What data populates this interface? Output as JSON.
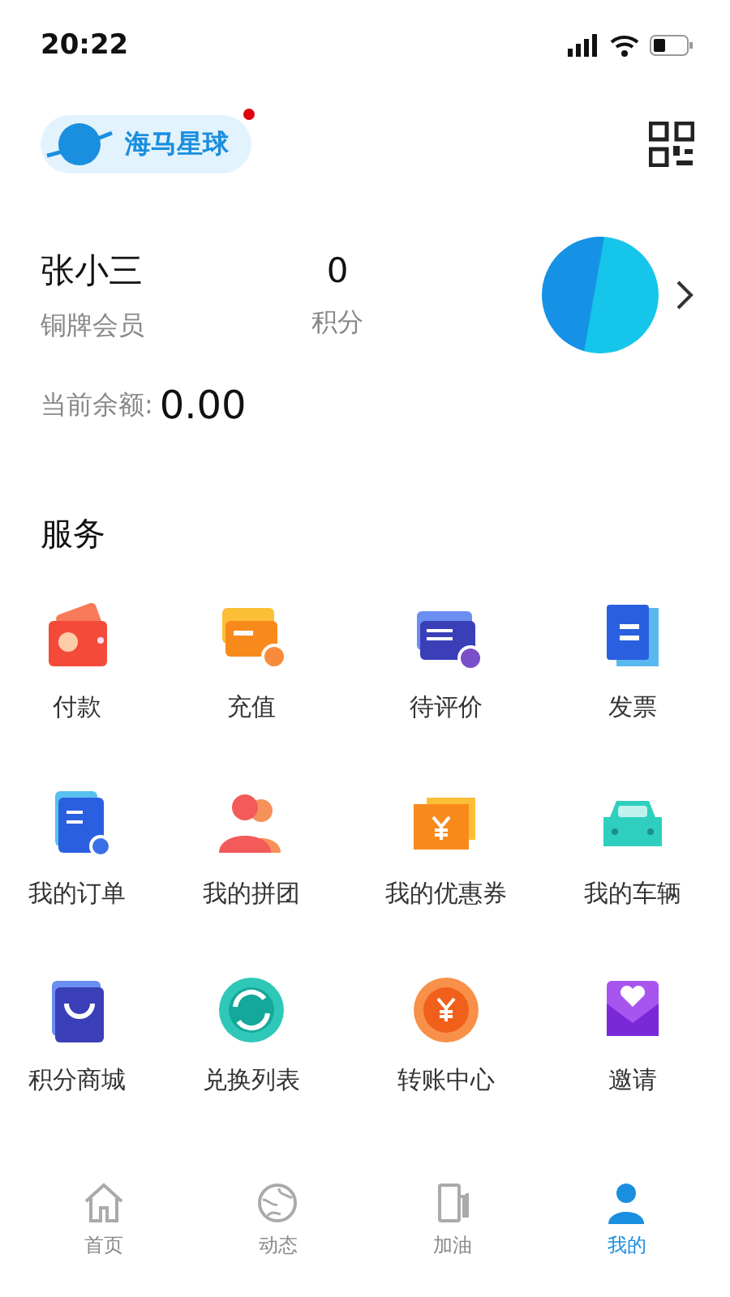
{
  "status_bar": {
    "time": "20:22"
  },
  "header": {
    "logo_text": "海马星球"
  },
  "profile": {
    "name": "张小三",
    "level": "铜牌会员",
    "points": "0",
    "points_label": "积分"
  },
  "balance": {
    "label": "当前余额:",
    "value": "0.00"
  },
  "services": {
    "title": "服务",
    "items": [
      {
        "label": "付款",
        "kind": "wallet"
      },
      {
        "label": "充值",
        "kind": "card"
      },
      {
        "label": "待评价",
        "kind": "review"
      },
      {
        "label": "发票",
        "kind": "receipt"
      },
      {
        "label": "我的订单",
        "kind": "order"
      },
      {
        "label": "我的拼团",
        "kind": "group"
      },
      {
        "label": "我的优惠券",
        "kind": "coupon"
      },
      {
        "label": "我的车辆",
        "kind": "car"
      },
      {
        "label": "积分商城",
        "kind": "shop"
      },
      {
        "label": "兑换列表",
        "kind": "exchange"
      },
      {
        "label": "转账中心",
        "kind": "transfer"
      },
      {
        "label": "邀请",
        "kind": "invite"
      }
    ]
  },
  "tab_bar": [
    {
      "label": "首页",
      "kind": "home",
      "selected": false
    },
    {
      "label": "动态",
      "kind": "globe",
      "selected": false
    },
    {
      "label": "加油",
      "kind": "fuel",
      "selected": false
    },
    {
      "label": "我的",
      "kind": "user",
      "selected": true
    }
  ]
}
